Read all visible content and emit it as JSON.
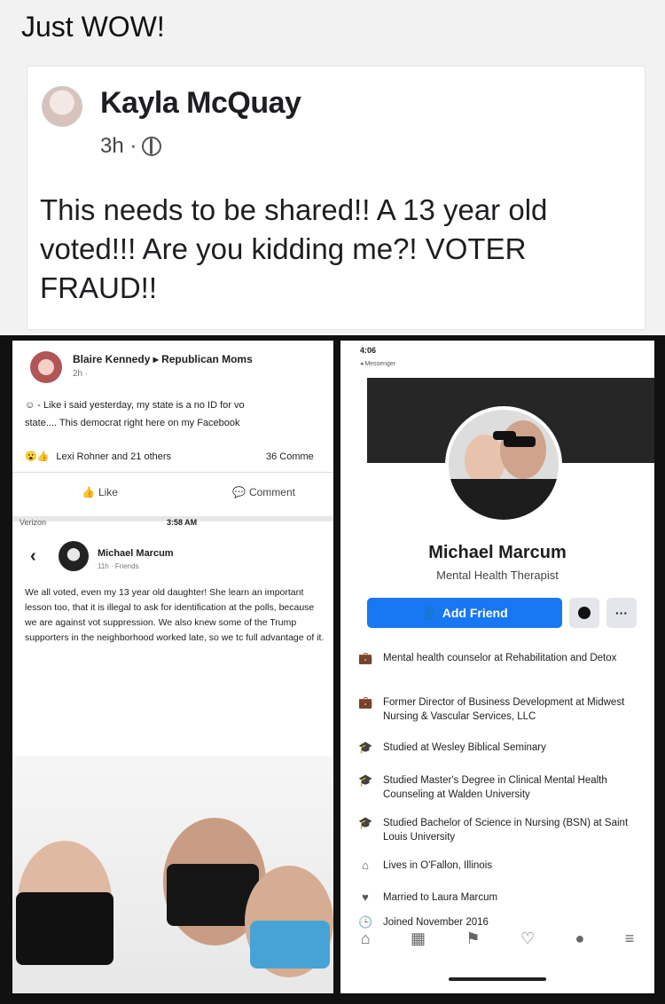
{
  "caption": "Just WOW!",
  "post": {
    "author": "Kayla McQuay",
    "time": "3h ·",
    "text": "This needs to be shared!! A 13 year old voted!!! Are you kidding me?! VOTER FRAUD!!"
  },
  "left_panel": {
    "top_post": {
      "author": "Blaire Kennedy",
      "arrow": "▸",
      "group": "Republican Moms",
      "time": "2h ·",
      "line1": "- Like i said yesterday, my state is a no ID for vo",
      "line2": "state.... This democrat right here on my Facebook",
      "reactions": "Lexi Rohner and 21 others",
      "comments": "36 Comme",
      "like_label": "Like",
      "comment_label": "Comment"
    },
    "screenshot": {
      "carrier": "Verizon",
      "clock": "3:58 AM",
      "name": "Michael Marcum",
      "sub": "11h · Friends",
      "text": "We all voted, even my 13 year old daughter! She learn an important lesson too, that it is illegal to ask for identification at the polls, because we are against vot suppression. We also knew some of the Trump supporters in the neighborhood worked late, so we tc full advantage of it."
    }
  },
  "right_panel": {
    "time": "4:06",
    "app": "◂ Messenger",
    "name": "Michael Marcum",
    "title": "Mental Health Therapist",
    "add_friend": "Add Friend",
    "more": "···",
    "info": [
      {
        "icon": "briefcase-icon",
        "text": "Mental health counselor at Rehabilitation and Detox"
      },
      {
        "icon": "briefcase-icon",
        "text": "Former Director of Business Development at Midwest Nursing & Vascular Services, LLC"
      },
      {
        "icon": "graduation-icon",
        "text": "Studied at Wesley Biblical Seminary"
      },
      {
        "icon": "graduation-icon",
        "text": "Studied Master's Degree in Clinical Mental Health Counseling at Walden University"
      },
      {
        "icon": "graduation-icon",
        "text": "Studied Bachelor of Science in Nursing (BSN) at Saint Louis University"
      },
      {
        "icon": "home-icon",
        "text": "Lives in O'Fallon, Illinois"
      },
      {
        "icon": "heart-icon",
        "text": "Married to Laura Marcum"
      },
      {
        "icon": "clock-icon",
        "text": "Joined November 2016"
      }
    ],
    "nav": [
      "⌂",
      "▦",
      "⚑",
      "♡",
      "●",
      "≡"
    ]
  }
}
